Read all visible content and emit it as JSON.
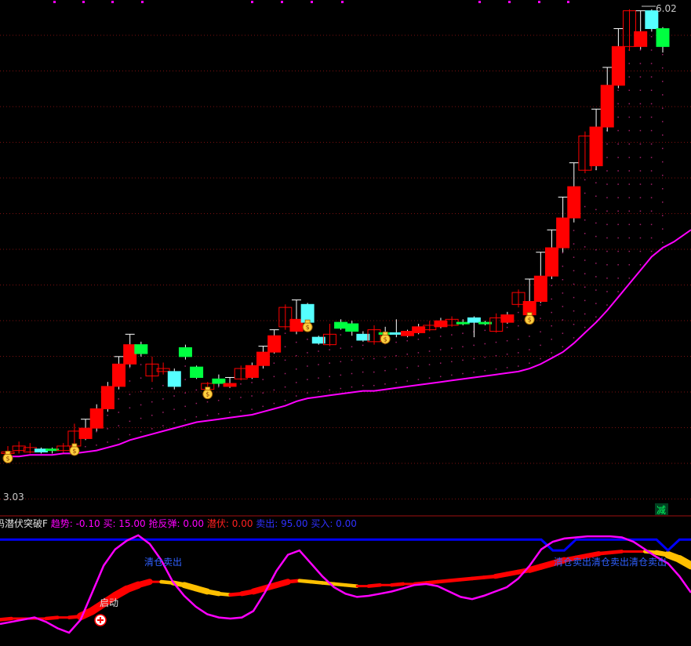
{
  "main_panel": {
    "high_label": "6.02",
    "low_label": "3.03",
    "reduce_badge": "减"
  },
  "indicator_header": {
    "name": "码潜伏突破F",
    "items": [
      {
        "text": "趋势: -0.10",
        "color": "#ff00ff"
      },
      {
        "text": "买: 15.00",
        "color": "#ff00ff"
      },
      {
        "text": "抢反弹: 0.00",
        "color": "#ff00ff"
      },
      {
        "text": "潜伏: 0.00",
        "color": "#ff2020"
      },
      {
        "text": "卖出: 95.00",
        "color": "#3030ff"
      },
      {
        "text": "买入: 0.00",
        "color": "#3030ff"
      }
    ]
  },
  "annotations": {
    "start": "启动",
    "sell_1": "清仓卖出",
    "sell_2": "清仓卖出清仓卖出清仓卖出"
  },
  "colors": {
    "up": "#ff0000",
    "down_green": "#00ff40",
    "down_cyan": "#55ffff",
    "ma": "#ff00ff",
    "grid": "#7a1010",
    "blue_line": "#0000ff",
    "trend_red": "#ff0000",
    "trend_yellow": "#ffc000"
  },
  "chart_data": [
    {
      "type": "candlestick",
      "title": "",
      "ylim": [
        2.7,
        6.05
      ],
      "candles": [
        {
          "o": 3.05,
          "c": 3.06,
          "h": 3.1,
          "l": 3.03,
          "style": "hollow"
        },
        {
          "o": 3.07,
          "c": 3.1,
          "h": 3.13,
          "l": 3.05,
          "style": "hollow"
        },
        {
          "o": 3.06,
          "c": 3.09,
          "h": 3.12,
          "l": 3.05,
          "style": "hollow"
        },
        {
          "o": 3.08,
          "c": 3.06,
          "h": 3.09,
          "l": 3.05,
          "style": "cyan"
        },
        {
          "o": 3.08,
          "c": 3.07,
          "h": 3.09,
          "l": 3.05,
          "style": "green"
        },
        {
          "o": 3.07,
          "c": 3.1,
          "h": 3.12,
          "l": 3.05,
          "style": "hollow"
        },
        {
          "o": 3.1,
          "c": 3.2,
          "h": 3.25,
          "l": 3.09,
          "style": "hollow"
        },
        {
          "o": 3.15,
          "c": 3.22,
          "h": 3.28,
          "l": 3.14,
          "style": "filled"
        },
        {
          "o": 3.22,
          "c": 3.35,
          "h": 3.38,
          "l": 3.2,
          "style": "filled"
        },
        {
          "o": 3.35,
          "c": 3.5,
          "h": 3.53,
          "l": 3.33,
          "style": "filled"
        },
        {
          "o": 3.5,
          "c": 3.65,
          "h": 3.7,
          "l": 3.48,
          "style": "filled"
        },
        {
          "o": 3.65,
          "c": 3.78,
          "h": 3.85,
          "l": 3.63,
          "style": "filled"
        },
        {
          "o": 3.78,
          "c": 3.72,
          "h": 3.8,
          "l": 3.7,
          "style": "green"
        },
        {
          "o": 3.65,
          "c": 3.57,
          "h": 3.7,
          "l": 3.53,
          "style": "hollow"
        },
        {
          "o": 3.62,
          "c": 3.6,
          "h": 3.66,
          "l": 3.58,
          "style": "hollow"
        },
        {
          "o": 3.6,
          "c": 3.5,
          "h": 3.62,
          "l": 3.48,
          "style": "cyan"
        },
        {
          "o": 3.76,
          "c": 3.7,
          "h": 3.78,
          "l": 3.68,
          "style": "green"
        },
        {
          "o": 3.63,
          "c": 3.56,
          "h": 3.64,
          "l": 3.55,
          "style": "green"
        },
        {
          "o": 3.52,
          "c": 3.48,
          "h": 3.53,
          "l": 3.47,
          "style": "hollow"
        },
        {
          "o": 3.52,
          "c": 3.55,
          "h": 3.58,
          "l": 3.5,
          "style": "green"
        },
        {
          "o": 3.5,
          "c": 3.52,
          "h": 3.56,
          "l": 3.49,
          "style": "filled"
        },
        {
          "o": 3.55,
          "c": 3.62,
          "h": 3.64,
          "l": 3.54,
          "style": "hollow"
        },
        {
          "o": 3.56,
          "c": 3.64,
          "h": 3.66,
          "l": 3.55,
          "style": "filled"
        },
        {
          "o": 3.64,
          "c": 3.73,
          "h": 3.77,
          "l": 3.62,
          "style": "filled"
        },
        {
          "o": 3.73,
          "c": 3.84,
          "h": 3.88,
          "l": 3.72,
          "style": "filled"
        },
        {
          "o": 3.9,
          "c": 4.03,
          "h": 4.05,
          "l": 3.88,
          "style": "hollow"
        },
        {
          "o": 3.87,
          "c": 3.95,
          "h": 4.08,
          "l": 3.85,
          "style": "filled"
        },
        {
          "o": 4.05,
          "c": 3.93,
          "h": 4.06,
          "l": 3.9,
          "style": "cyan"
        },
        {
          "o": 3.83,
          "c": 3.79,
          "h": 3.84,
          "l": 3.78,
          "style": "cyan"
        },
        {
          "o": 3.78,
          "c": 3.85,
          "h": 3.92,
          "l": 3.77,
          "style": "hollow"
        },
        {
          "o": 3.93,
          "c": 3.89,
          "h": 3.95,
          "l": 3.88,
          "style": "green"
        },
        {
          "o": 3.92,
          "c": 3.87,
          "h": 3.94,
          "l": 3.84,
          "style": "green"
        },
        {
          "o": 3.85,
          "c": 3.81,
          "h": 3.87,
          "l": 3.8,
          "style": "cyan"
        },
        {
          "o": 3.8,
          "c": 3.88,
          "h": 3.91,
          "l": 3.78,
          "style": "hollow"
        },
        {
          "o": 3.86,
          "c": 3.85,
          "h": 3.9,
          "l": 3.82,
          "style": "green"
        },
        {
          "o": 3.85,
          "c": 3.86,
          "h": 3.95,
          "l": 3.83,
          "style": "cyan"
        },
        {
          "o": 3.84,
          "c": 3.87,
          "h": 3.88,
          "l": 3.83,
          "style": "filled"
        },
        {
          "o": 3.86,
          "c": 3.9,
          "h": 3.92,
          "l": 3.85,
          "style": "filled"
        },
        {
          "o": 3.88,
          "c": 3.91,
          "h": 3.94,
          "l": 3.87,
          "style": "hollow"
        },
        {
          "o": 3.9,
          "c": 3.94,
          "h": 3.96,
          "l": 3.89,
          "style": "filled"
        },
        {
          "o": 3.91,
          "c": 3.95,
          "h": 3.97,
          "l": 3.9,
          "style": "hollow"
        },
        {
          "o": 3.93,
          "c": 3.92,
          "h": 3.95,
          "l": 3.91,
          "style": "green"
        },
        {
          "o": 3.96,
          "c": 3.93,
          "h": 3.97,
          "l": 3.83,
          "style": "cyan"
        },
        {
          "o": 3.93,
          "c": 3.92,
          "h": 3.94,
          "l": 3.91,
          "style": "green"
        },
        {
          "o": 3.87,
          "c": 3.96,
          "h": 3.99,
          "l": 3.86,
          "style": "hollow"
        },
        {
          "o": 3.93,
          "c": 3.98,
          "h": 4.0,
          "l": 3.92,
          "style": "filled"
        },
        {
          "o": 4.05,
          "c": 4.13,
          "h": 4.15,
          "l": 4.03,
          "style": "hollow"
        },
        {
          "o": 3.98,
          "c": 4.07,
          "h": 4.22,
          "l": 3.97,
          "style": "filled"
        },
        {
          "o": 4.07,
          "c": 4.24,
          "h": 4.4,
          "l": 4.06,
          "style": "filled"
        },
        {
          "o": 4.24,
          "c": 4.43,
          "h": 4.55,
          "l": 4.22,
          "style": "filled"
        },
        {
          "o": 4.43,
          "c": 4.63,
          "h": 4.77,
          "l": 4.4,
          "style": "filled"
        },
        {
          "o": 4.63,
          "c": 4.84,
          "h": 5.0,
          "l": 4.6,
          "style": "filled"
        },
        {
          "o": 4.95,
          "c": 5.18,
          "h": 5.21,
          "l": 4.93,
          "style": "hollow"
        },
        {
          "o": 4.98,
          "c": 5.24,
          "h": 5.36,
          "l": 4.95,
          "style": "filled"
        },
        {
          "o": 5.24,
          "c": 5.52,
          "h": 5.64,
          "l": 5.21,
          "style": "filled"
        },
        {
          "o": 5.52,
          "c": 5.78,
          "h": 5.9,
          "l": 5.5,
          "style": "filled"
        },
        {
          "o": 5.78,
          "c": 6.02,
          "h": 6.03,
          "l": 5.75,
          "style": "hollow"
        },
        {
          "o": 5.78,
          "c": 5.88,
          "h": 6.02,
          "l": 5.76,
          "style": "filled"
        },
        {
          "o": 6.02,
          "c": 5.9,
          "h": 6.03,
          "l": 5.88,
          "style": "cyan"
        },
        {
          "o": 5.9,
          "c": 5.78,
          "h": 5.91,
          "l": 5.74,
          "style": "green"
        }
      ],
      "moving_average": [
        3.03,
        3.03,
        3.04,
        3.04,
        3.04,
        3.05,
        3.05,
        3.06,
        3.07,
        3.09,
        3.11,
        3.14,
        3.16,
        3.18,
        3.2,
        3.22,
        3.24,
        3.26,
        3.27,
        3.28,
        3.29,
        3.3,
        3.31,
        3.33,
        3.35,
        3.37,
        3.4,
        3.42,
        3.43,
        3.44,
        3.45,
        3.46,
        3.47,
        3.47,
        3.48,
        3.49,
        3.5,
        3.51,
        3.52,
        3.53,
        3.54,
        3.55,
        3.56,
        3.57,
        3.58,
        3.59,
        3.6,
        3.62,
        3.65,
        3.69,
        3.73,
        3.79,
        3.86,
        3.93,
        4.01,
        4.1,
        4.19,
        4.28,
        4.37,
        4.43,
        4.47
      ],
      "signal_markers": [
        0,
        6,
        18,
        27,
        34,
        47
      ]
    },
    {
      "type": "line",
      "title": "",
      "ylim": [
        0,
        100
      ],
      "series": [
        {
          "name": "",
          "color": "#ff00ff",
          "values": [
            16,
            18,
            20,
            22,
            18,
            12,
            8,
            20,
            45,
            70,
            85,
            93,
            98,
            90,
            75,
            55,
            42,
            32,
            25,
            22,
            21,
            22,
            28,
            45,
            65,
            80,
            84,
            72,
            60,
            50,
            44,
            41,
            42,
            44,
            46,
            49,
            52,
            53,
            51,
            46,
            41,
            39,
            42,
            46,
            50,
            58,
            70,
            85,
            92,
            95,
            96,
            97,
            97,
            97,
            96,
            92,
            85,
            78,
            72,
            60,
            45
          ]
        },
        {
          "name": "",
          "color": "#0000ff",
          "values": [
            94,
            94,
            94,
            94,
            94,
            94,
            94,
            94,
            94,
            94,
            94,
            94,
            94,
            94,
            94,
            94,
            94,
            94,
            94,
            94,
            94,
            94,
            94,
            94,
            94,
            94,
            94,
            94,
            94,
            94,
            94,
            94,
            94,
            94,
            94,
            94,
            94,
            94,
            94,
            94,
            94,
            94,
            94,
            94,
            94,
            94,
            94,
            94,
            84,
            84,
            94,
            94,
            94,
            94,
            94,
            94,
            94,
            94,
            84,
            94,
            94
          ]
        },
        {
          "name": "",
          "color": "#ff0000",
          "values": [
            20,
            21,
            21,
            21,
            21,
            22,
            22,
            23,
            28,
            35,
            42,
            48,
            52,
            55,
            55,
            54,
            52,
            49,
            46,
            44,
            43,
            44,
            46,
            49,
            52,
            55,
            56,
            55,
            54,
            53,
            52,
            51,
            51,
            52,
            52,
            53,
            53,
            54,
            55,
            56,
            57,
            58,
            59,
            60,
            62,
            64,
            66,
            69,
            72,
            75,
            77,
            79,
            81,
            82,
            83,
            83,
            83,
            82,
            80,
            76,
            70
          ]
        }
      ],
      "markers": [
        7
      ]
    }
  ]
}
